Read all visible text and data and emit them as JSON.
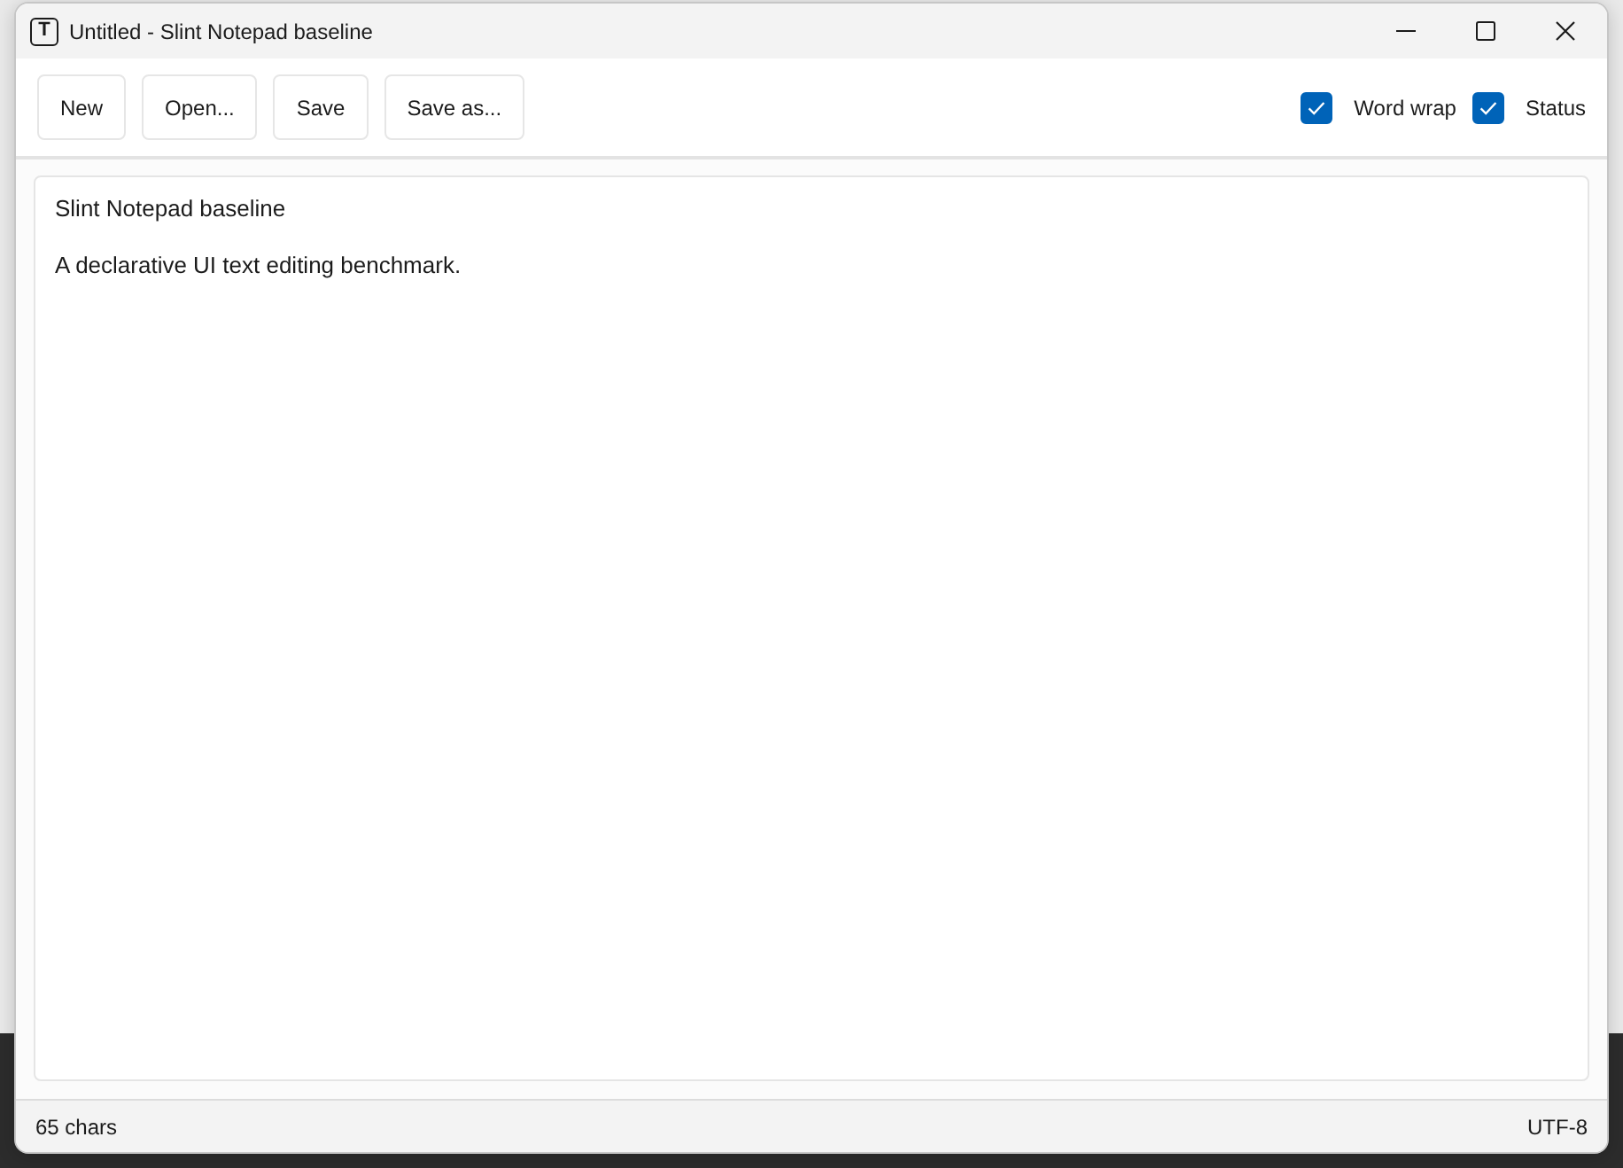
{
  "window": {
    "icon_letter": "T",
    "title": "Untitled - Slint Notepad baseline"
  },
  "toolbar": {
    "buttons": [
      {
        "label": "New"
      },
      {
        "label": "Open..."
      },
      {
        "label": "Save"
      },
      {
        "label": "Save as..."
      }
    ],
    "toggles": [
      {
        "label": "Word wrap",
        "checked": true
      },
      {
        "label": "Status",
        "checked": true
      }
    ]
  },
  "editor": {
    "paragraphs": [
      "Slint Notepad baseline",
      "A declarative UI text editing benchmark."
    ]
  },
  "status_bar": {
    "left": "65 chars",
    "right": "UTF-8"
  }
}
